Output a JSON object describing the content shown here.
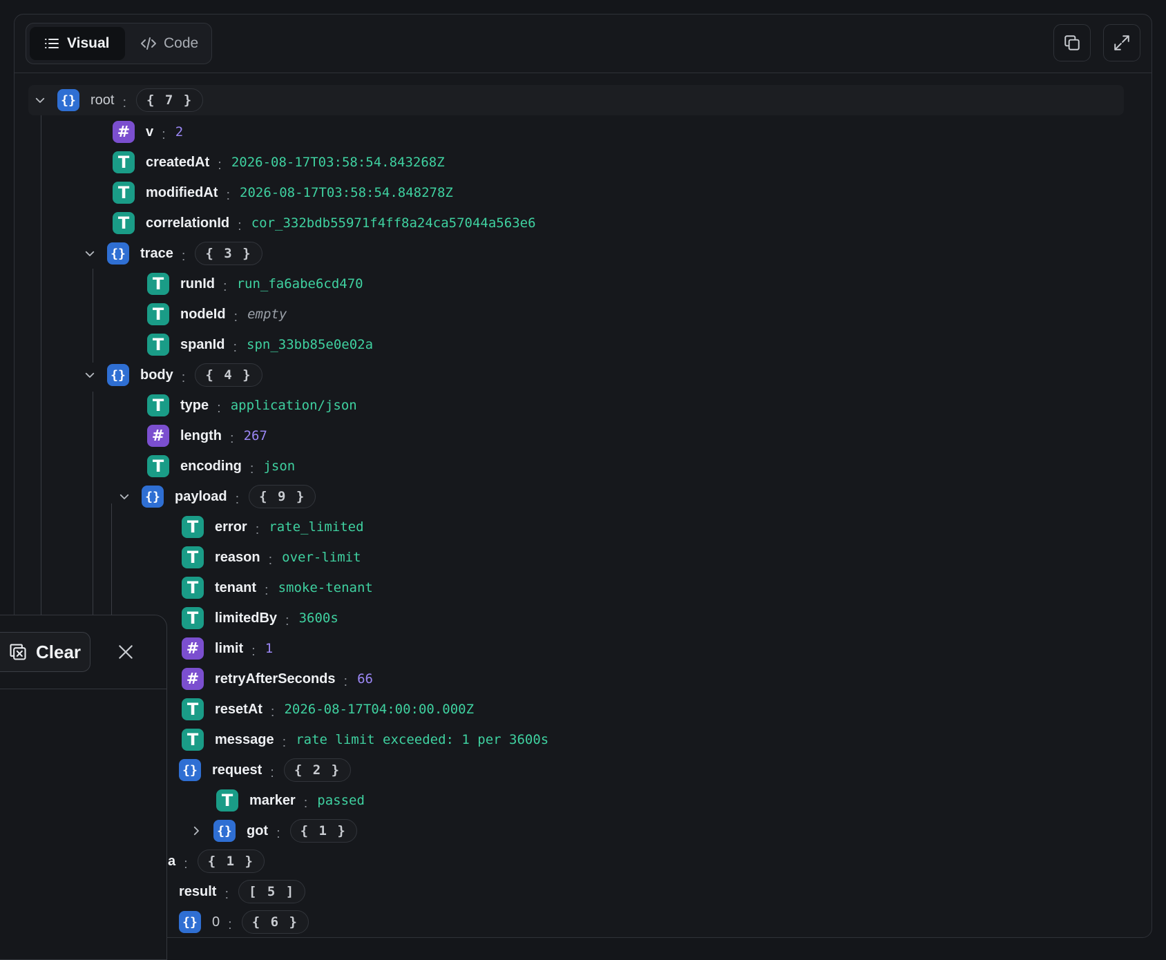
{
  "toolbar": {
    "tabs": [
      {
        "label": "Visual",
        "icon": "list-icon",
        "active": true
      },
      {
        "label": "Code",
        "icon": "code-icon",
        "active": false
      }
    ],
    "actions": [
      {
        "icon": "copy-icon"
      },
      {
        "icon": "expand-icon"
      }
    ]
  },
  "tree": {
    "root": {
      "key": "root",
      "count": "{ 7 }"
    },
    "v": {
      "key": "v",
      "value": "2"
    },
    "createdAt": {
      "key": "createdAt",
      "value": "2026-08-17T03:58:54.843268Z"
    },
    "modifiedAt": {
      "key": "modifiedAt",
      "value": "2026-08-17T03:58:54.848278Z"
    },
    "correlationId": {
      "key": "correlationId",
      "value": "cor_332bdb55971f4ff8a24ca57044a563e6"
    },
    "trace": {
      "key": "trace",
      "count": "{ 3 }"
    },
    "runId": {
      "key": "runId",
      "value": "run_fa6abe6cd470"
    },
    "nodeId": {
      "key": "nodeId",
      "value": "empty"
    },
    "spanId": {
      "key": "spanId",
      "value": "spn_33bb85e0e02a"
    },
    "body": {
      "key": "body",
      "count": "{ 4 }"
    },
    "type": {
      "key": "type",
      "value": "application/json"
    },
    "length": {
      "key": "length",
      "value": "267"
    },
    "encoding": {
      "key": "encoding",
      "value": "json"
    },
    "payload": {
      "key": "payload",
      "count": "{ 9 }"
    },
    "error": {
      "key": "error",
      "value": "rate_limited"
    },
    "reason": {
      "key": "reason",
      "value": "over-limit"
    },
    "tenant": {
      "key": "tenant",
      "value": "smoke-tenant"
    },
    "limitedBy": {
      "key": "limitedBy",
      "value": "3600s"
    },
    "limit": {
      "key": "limit",
      "value": "1"
    },
    "retryAfterSeconds": {
      "key": "retryAfterSeconds",
      "value": "66"
    },
    "resetAt": {
      "key": "resetAt",
      "value": "2026-08-17T04:00:00.000Z"
    },
    "message": {
      "key": "message",
      "value": "rate limit exceeded: 1 per 3600s"
    },
    "request": {
      "key": "request",
      "count": "{ 2 }"
    },
    "marker": {
      "key": "marker",
      "value": "passed"
    },
    "got": {
      "key": "got",
      "count": "{ 1 }"
    },
    "a": {
      "key": "a",
      "count": "{ 1 }"
    },
    "result": {
      "key": "result",
      "count": "[ 5 ]"
    },
    "item0": {
      "key": "0",
      "count": "{ 6 }"
    }
  },
  "overlay": {
    "clear_label": "Clear"
  }
}
